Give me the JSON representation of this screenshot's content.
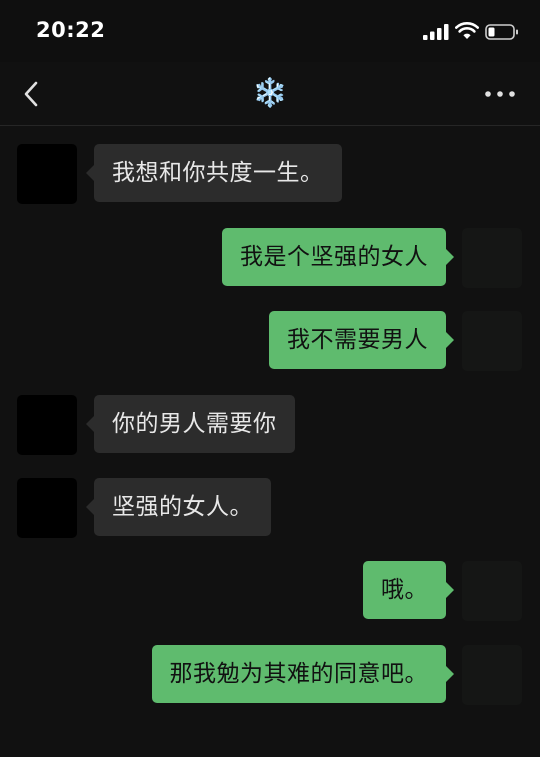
{
  "status_bar": {
    "time": "20:22",
    "signal_icon": "cellular-signal-icon",
    "wifi_icon": "wifi-icon",
    "battery_icon": "battery-low-icon"
  },
  "nav": {
    "back_icon": "chevron-left-icon",
    "title": "❄️",
    "more_icon": "more-horizontal-icon"
  },
  "colors": {
    "incoming_bubble": "#2c2c2c",
    "outgoing_bubble": "#5fbb6e",
    "background": "#111111"
  },
  "messages": [
    {
      "side": "in",
      "text": "我想和你共度一生。"
    },
    {
      "side": "out",
      "text": "我是个坚强的女人"
    },
    {
      "side": "out",
      "text": "我不需要男人"
    },
    {
      "side": "in",
      "text": "你的男人需要你"
    },
    {
      "side": "in",
      "text": "坚强的女人。"
    },
    {
      "side": "out",
      "text": "哦。"
    },
    {
      "side": "out",
      "text": "那我勉为其难的同意吧。"
    }
  ]
}
